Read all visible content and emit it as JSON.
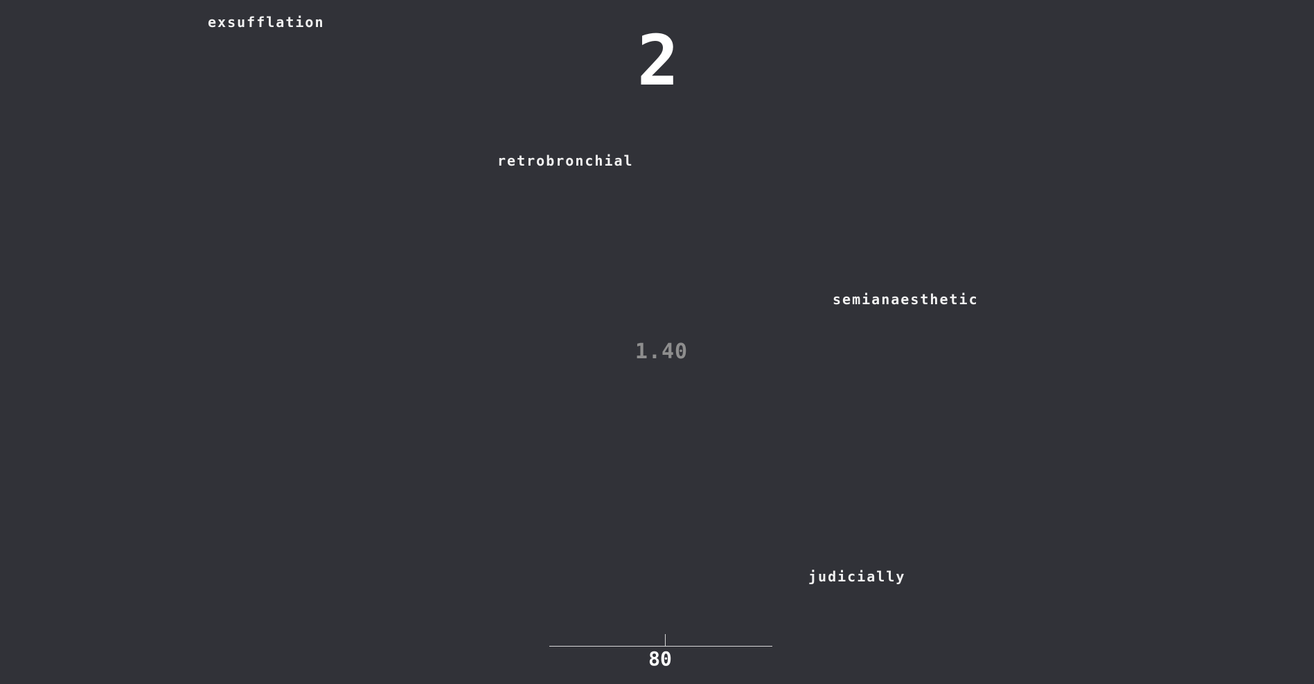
{
  "words": [
    "exsufflation",
    "retrobronchial",
    "semianaesthetic",
    "judicially"
  ],
  "score": "2",
  "multiplier": "1.40",
  "timer": {
    "value": "80",
    "progress_percent": 52
  },
  "colors": {
    "background": "#313238",
    "text": "#ffffff",
    "multiplier": "#8e8e8e"
  }
}
